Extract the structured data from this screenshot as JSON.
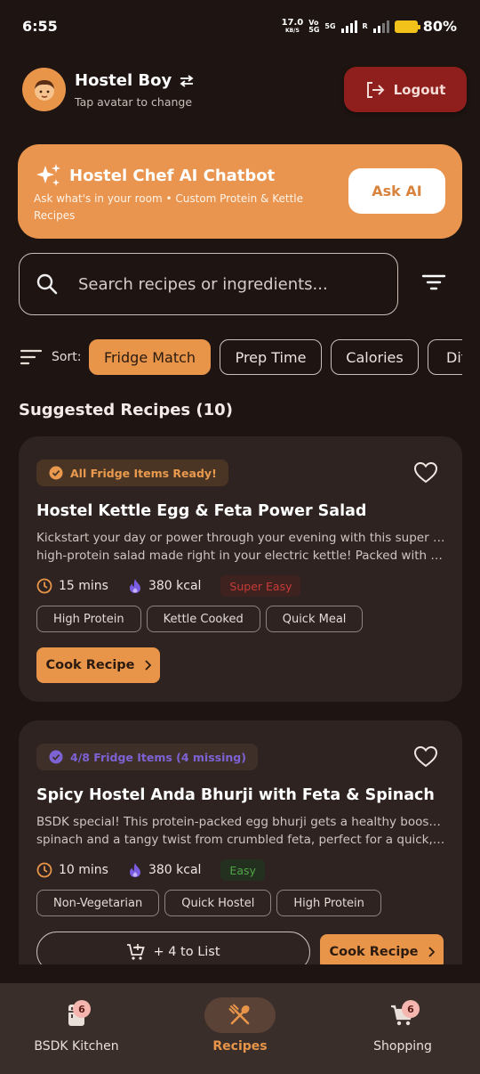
{
  "status_bar": {
    "time": "6:55",
    "speed_value": "17.0",
    "speed_unit": "KB/S",
    "net1": "Vo",
    "net1_sub": "5G",
    "net2": "5G",
    "roaming": "R",
    "battery": "80%"
  },
  "header": {
    "user_name": "Hostel Boy",
    "user_hint": "Tap avatar to change",
    "logout_label": "Logout"
  },
  "ai_banner": {
    "title": "Hostel Chef AI Chatbot",
    "subtitle": "Ask what's in your room • Custom Protein & Kettle Recipes",
    "button_label": "Ask AI"
  },
  "search": {
    "placeholder": "Search recipes or ingredients..."
  },
  "sort": {
    "label": "Sort:",
    "options": [
      "Fridge Match",
      "Prep Time",
      "Calories",
      "Difficulty"
    ],
    "active": "Fridge Match"
  },
  "section_title": "Suggested Recipes (10)",
  "recipes": [
    {
      "badge": "All Fridge Items Ready!",
      "title": "Hostel Kettle Egg & Feta Power Salad",
      "desc_line1": "Kickstart your day or power through your evening with this super easy,",
      "desc_line2": "high-protein salad made right in your electric kettle! Packed with over protein and healthy fats",
      "time": "15 mins",
      "calories": "380 kcal",
      "difficulty": "Super Easy",
      "tags": [
        "High Protein",
        "Kettle Cooked",
        "Quick Meal"
      ],
      "cook_label": "Cook Recipe"
    },
    {
      "badge": "4/8 Fridge Items (4 missing)",
      "title": "Spicy Hostel Anda Bhurji with Feta & Spinach",
      "desc_line1": "BSDK special! This protein-packed egg bhurji gets a healthy boost from",
      "desc_line2": "spinach and a tangy twist from crumbled feta, perfect for a quick, satisfying meal",
      "time": "10 mins",
      "calories": "380 kcal",
      "difficulty": "Easy",
      "tags": [
        "Non-Vegetarian",
        "Quick Hostel",
        "High Protein"
      ],
      "list_label": "+ 4 to List",
      "cook_label": "Cook Recipe"
    }
  ],
  "bottom_nav": {
    "items": [
      {
        "label": "BSDK Kitchen",
        "badge": "6"
      },
      {
        "label": "Recipes"
      },
      {
        "label": "Shopping",
        "badge": "6"
      }
    ],
    "active": "Recipes"
  },
  "colors": {
    "background": "#1e1512",
    "accent": "#e8954a",
    "logout": "#8f1f1c",
    "card": "#2e2320",
    "nav": "#3a2e2b"
  }
}
